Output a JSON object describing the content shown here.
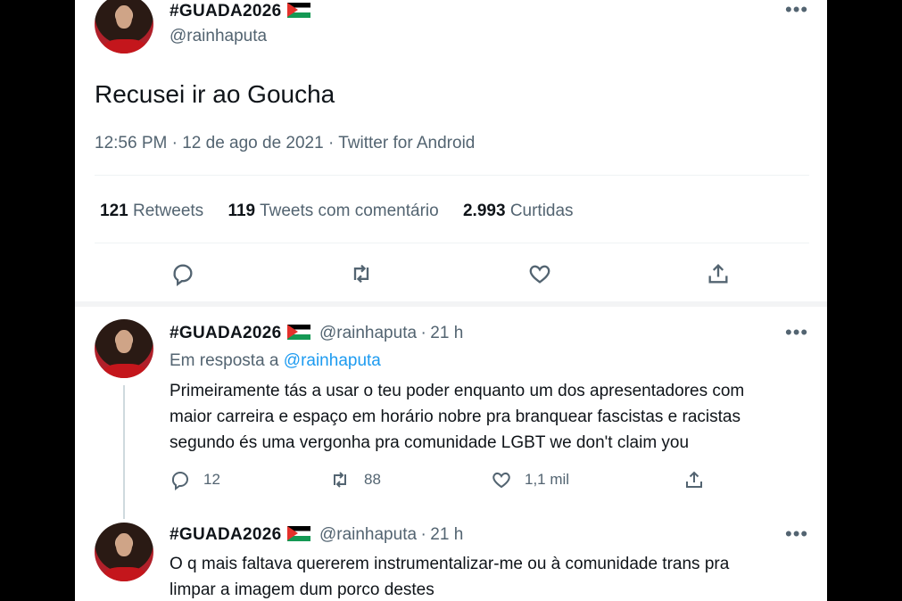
{
  "main_tweet": {
    "display_name": "#GUADA2026",
    "handle": "@rainhaputa",
    "text": "Recusei ir ao Goucha",
    "meta": "12:56 PM · 12 de ago de 2021 · Twitter for Android",
    "stats": {
      "retweets_count": "121",
      "retweets_label": "Retweets",
      "quotes_count": "119",
      "quotes_label": "Tweets com comentário",
      "likes_count": "2.993",
      "likes_label": "Curtidas"
    },
    "action_icons": [
      "reply-icon",
      "retweet-icon",
      "like-icon",
      "share-icon"
    ]
  },
  "replies": [
    {
      "display_name": "#GUADA2026",
      "handle": "@rainhaputa",
      "separator": "·",
      "time": "21 h",
      "reply_prefix": "Em resposta a",
      "reply_to": "@rainhaputa",
      "text_lines": [
        "Primeiramente tás a usar o teu poder enquanto um dos apresentadores com",
        "maior carreira e espaço em horário nobre pra branquear fascistas e racistas",
        "segundo és uma vergonha pra comunidade LGBT we don't claim you"
      ],
      "reply_count": "12",
      "retweet_count": "88",
      "like_count": "1,1 mil"
    },
    {
      "display_name": "#GUADA2026",
      "handle": "@rainhaputa",
      "separator": "·",
      "time": "21 h",
      "text_lines": [
        "O q mais faltava quererem instrumentalizar-me ou à comunidade trans pra",
        "limpar a imagem dum porco destes"
      ]
    }
  ],
  "more_label": "•••",
  "colors": {
    "accent": "#1d9bf0",
    "secondary_text": "#536471",
    "divider": "#eff3f4",
    "thread_line": "#cfd9de"
  }
}
